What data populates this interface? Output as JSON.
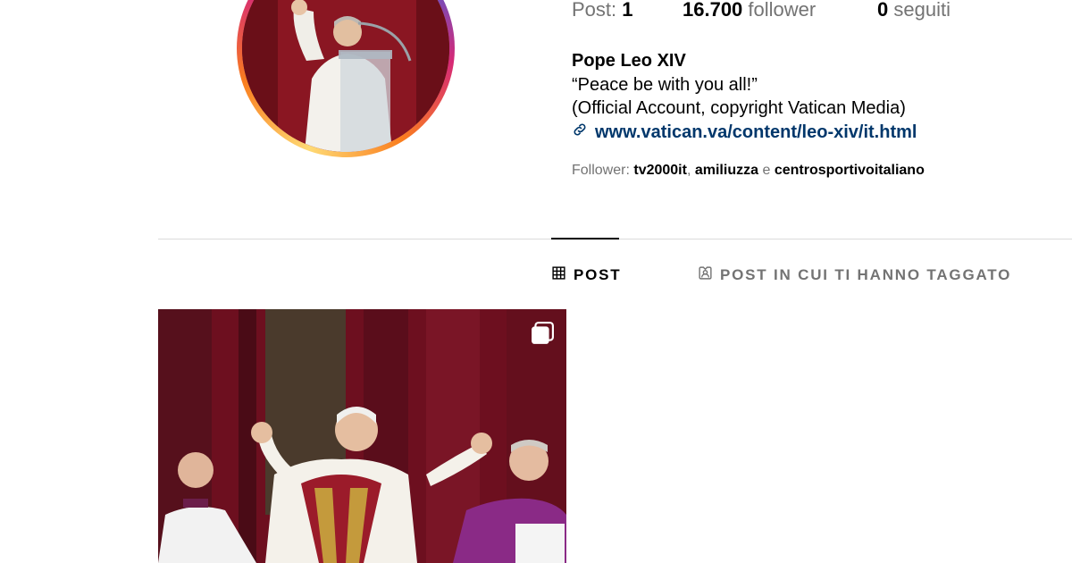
{
  "profile": {
    "stats": {
      "posts_label": "Post:",
      "posts_count": "1",
      "followers_count": "16.700",
      "followers_label": "follower",
      "following_count": "0",
      "following_label": "seguiti"
    },
    "name": "Pope Leo XIV",
    "bio_line1": "“Peace be with you all!”",
    "bio_line2": "(Official Account, copyright Vatican Media)",
    "link": "www.vatican.va/content/leo-xiv/it.html",
    "followed_by": {
      "label": "Follower:",
      "user1": "tv2000it",
      "sep1": ",",
      "user2": "amiliuzza",
      "sep2": "e",
      "user3": "centrosportivoitaliano"
    }
  },
  "tabs": [
    {
      "label": "POST",
      "icon": "grid-icon",
      "active": true
    },
    {
      "label": "POST IN CUI TI HANNO TAGGATO",
      "icon": "tagged-user-icon",
      "active": false
    }
  ],
  "posts": [
    {
      "type": "carousel",
      "icon": "carousel-icon"
    }
  ],
  "colors": {
    "link": "#00376b",
    "muted": "#737373",
    "divider": "#dbdbdb"
  }
}
